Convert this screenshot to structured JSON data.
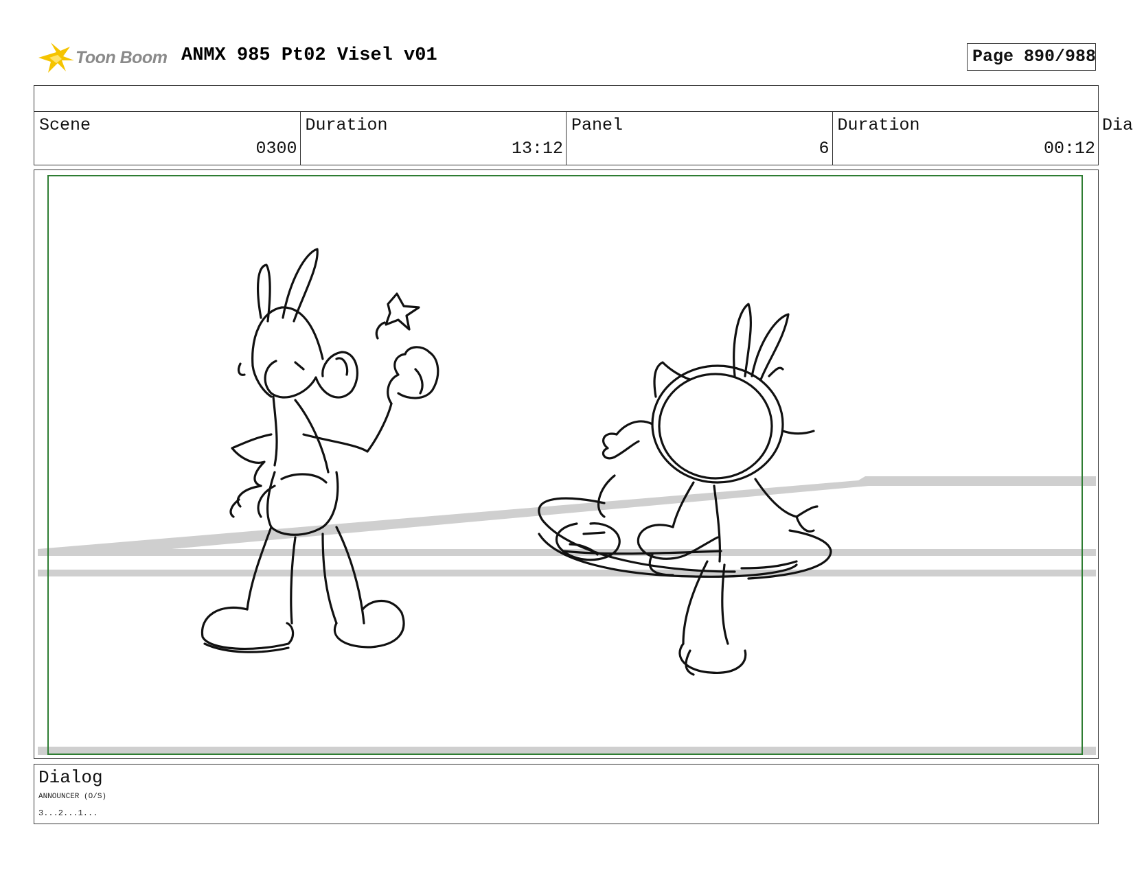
{
  "header": {
    "brand": "Toon Boom",
    "project_title": "ANMX 985 Pt02 Visel v01",
    "page_label": "Page 890/988"
  },
  "info": {
    "scene_label": "Scene",
    "scene_value": "0300",
    "scene_duration_label": "Duration",
    "scene_duration_value": "13:12",
    "panel_label": "Panel",
    "panel_value": "6",
    "panel_duration_label": "Duration",
    "panel_duration_value": "00:12",
    "cut_off_label": "Dia"
  },
  "dialog": {
    "label": "Dialog",
    "speaker": "ANNOUNCER (O/S)",
    "line": "3...2...1..."
  },
  "colors": {
    "safe_frame": "#2e7d32",
    "stage_lines": "#cfcfcf",
    "sketch": "#111111",
    "logo_star": "#f5c400"
  },
  "icons": {
    "logo": "toon-boom-star-icon"
  }
}
